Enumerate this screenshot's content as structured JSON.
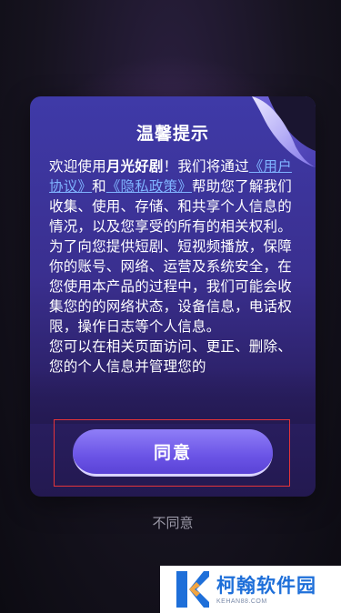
{
  "dialog": {
    "title": "温馨提示",
    "body": {
      "intro_prefix": "欢迎使用",
      "app_name": "月光好剧",
      "intro_suffix": "！我们将通过",
      "user_agreement_link": "《用户协议》",
      "and_text": "和",
      "privacy_policy_link": "《隐私政策》",
      "paragraph1_rest": "帮助您了解我们收集、使用、存储、和共享个人信息的情况，以及您享受的所有的相关权利。",
      "paragraph2": "为了向您提供短剧、短视频播放，保障你的账号、网络、运营及系统安全，在您使用本产品的过程中，我们可能会收集您的的网络状态，设备信息，电话权限，操作日志等个人信息。",
      "paragraph3": "您可以在相关页面访问、更正、删除、您的个人信息并管理您的"
    },
    "agree_label": "同意",
    "disagree_label": "不同意"
  },
  "watermark": {
    "name": "柯翰软件园",
    "domain": "KEHAN88.COM"
  },
  "colors": {
    "link": "#7fb3ff",
    "agree_button": "#6b54e6",
    "highlight_box": "#e3343a",
    "watermark_text": "#1e6fd9"
  }
}
